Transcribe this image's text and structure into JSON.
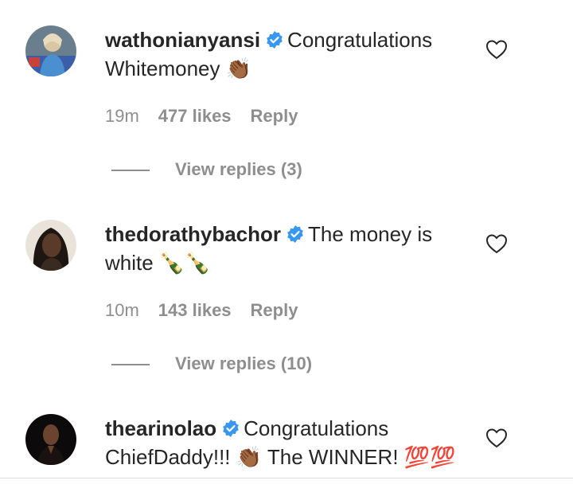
{
  "comments": [
    {
      "username": "wathonianyansi",
      "text_line1": "Congratulations",
      "text_line2": "Whitemoney 👏🏾",
      "time": "19m",
      "likes": "477 likes",
      "reply": "Reply",
      "view_replies": "View replies (3)",
      "avatar_icon": "avatar-icon"
    },
    {
      "username": "thedorathybachor",
      "text_line1": "The money is",
      "text_line2": "white 🍾🍾",
      "time": "10m",
      "likes": "143 likes",
      "reply": "Reply",
      "view_replies": "View replies (10)",
      "avatar_icon": "avatar-icon"
    },
    {
      "username": "thearinolao",
      "text_line1": "Congratulations",
      "text_line2": "ChiefDaddy!!! 👏🏾 The WINNER! 💯💯",
      "avatar_icon": "avatar-icon"
    }
  ],
  "colors": {
    "verified_blue": "#3897f0",
    "secondary_text": "#8e8e8e",
    "primary_text": "#262626"
  }
}
